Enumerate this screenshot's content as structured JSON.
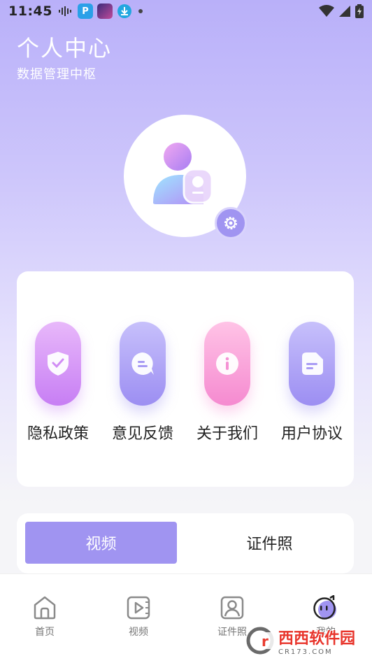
{
  "status_bar": {
    "time": "11:45"
  },
  "header": {
    "title": "个人中心",
    "subtitle": "数据管理中枢"
  },
  "links": [
    {
      "label": "隐私政策",
      "icon": "shield-check-icon",
      "color_top": "#e8b8fa",
      "color_bottom": "#c77ef4"
    },
    {
      "label": "意见反馈",
      "icon": "chat-bubble-icon",
      "color_top": "#c7c0fb",
      "color_bottom": "#9c8ef2"
    },
    {
      "label": "关于我们",
      "icon": "info-icon",
      "color_top": "#ffc3e6",
      "color_bottom": "#f58ad0"
    },
    {
      "label": "用户协议",
      "icon": "document-icon",
      "color_top": "#c7c0fb",
      "color_bottom": "#9c8ef2"
    }
  ],
  "tabs": {
    "active": "视频",
    "inactive": "证件照"
  },
  "bottom_nav": [
    {
      "label": "首页",
      "icon": "home-icon"
    },
    {
      "label": "视频",
      "icon": "video-icon"
    },
    {
      "label": "证件照",
      "icon": "id-photo-icon"
    },
    {
      "label": "我的",
      "icon": "profile-face-icon"
    }
  ],
  "watermark": {
    "text": "西西软件园",
    "sub": "CR173.COM"
  },
  "colors": {
    "accent": "#a094f1",
    "header_gradient_top": "#b9b0f9"
  }
}
